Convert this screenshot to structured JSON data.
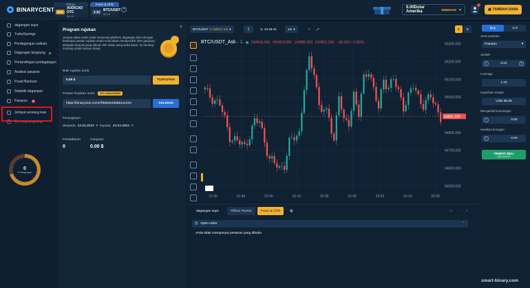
{
  "brand": {
    "name": "BINARYCENT"
  },
  "asset_tabs": [
    {
      "header": "Pilihan",
      "pct": "93%",
      "name": "AUD/CAD OTC",
      "price": "$1.00",
      "active": false
    },
    {
      "header": "Forex & CFD",
      "pct": "1:10",
      "name": "BTC/USDT",
      "price": "$3.00",
      "active": true
    }
  ],
  "topbar": {
    "add_asset": "+",
    "balance_value": "0.00Dolar Amerika",
    "balance_tag": "SEBENAR",
    "deposit_label": "TAMBAH DANA"
  },
  "sidebar": {
    "items": [
      {
        "label": "dagangan saya"
      },
      {
        "label": "TurboSavings"
      },
      {
        "label": "Perdagangan salinan"
      },
      {
        "label": "Dagangan langsung"
      },
      {
        "label": "Pertandingan perdagangan"
      },
      {
        "label": "Analisis pasaran"
      },
      {
        "label": "Pusat Bantuan"
      },
      {
        "label": "Statistik dagangan"
      },
      {
        "label": "Pasaran",
        "badge": "9"
      },
      {
        "label": "Jemput seorang kaw"
      },
      {
        "label": "Semuag langsung"
      }
    ],
    "donut": {
      "value": "0",
      "label": "Perdagangan"
    }
  },
  "referral": {
    "close": "×",
    "title": "Program rujukan",
    "description": "Jemput rakan anda untuk menyertai platform dagangan kami dengan beberapa pautan rujukan anda! Anda akan memperoleh 20% ganjaran daripada deposit yang dibuat oleh rakan yang anda bawa. Ia menang-menang untuk semua orang!",
    "bonus_label": "Baki rujukan anda",
    "bonus_value": "0.00 $",
    "withdraw_btn": "TUNTUTAN",
    "link_label": "Pautan Rujukan anda",
    "link_tag": "20% GANJARAN",
    "link_value": "https://binarycent.com/r/f868354d9661ec034",
    "copy_btn": "SALINAN",
    "stats_title": "Perangkaan",
    "date_from_label": "daripada",
    "date_from": "22.04.2023",
    "date_to_label": "kepada",
    "date_to": "22.04.2023",
    "signups_label": "Pendaftaran",
    "signups_value": "0",
    "earnings_label": "Ganjaran",
    "earnings_value": "0.00 $"
  },
  "chart_toolbar": {
    "asset": "BTC/USDT",
    "asset_mult": "1:10/$1(1:10)",
    "time": "23:25:43",
    "timeframe": "1m",
    "currency_a": "$",
    "currency_b": "€"
  },
  "chart_data": {
    "type": "candlestick",
    "title": "BTC/USDT_Ask · 1",
    "ohlc_text": {
      "o": "O64916.660",
      "h": "H64923.060",
      "l": "L64885.600",
      "c": "C64891.200",
      "chg": "−38.320 (−0.06%)"
    },
    "x_ticks": [
      "21:30",
      "21:45",
      "22:00",
      "22:15",
      "22:30",
      "22:45",
      "23:00",
      "23:15",
      "23:30"
    ],
    "y_ticks": [
      "65300.000",
      "65200.000",
      "65100.000",
      "65000.000",
      "64900.000",
      "64800.000",
      "64700.000",
      "64600.000",
      "64500.000"
    ],
    "ylim": [
      64470,
      65330
    ],
    "last_price": "64891.200",
    "last_price_value": 64891.2,
    "colors": {
      "up": "#26a69a",
      "down": "#ef5350"
    },
    "candle_count": 96,
    "anchors": [
      [
        0,
        65030
      ],
      [
        6,
        64960
      ],
      [
        10,
        64780
      ],
      [
        16,
        64720
      ],
      [
        20,
        64860
      ],
      [
        22,
        64860
      ],
      [
        26,
        64650
      ],
      [
        30,
        64600
      ],
      [
        32,
        64620
      ],
      [
        34,
        64740
      ],
      [
        38,
        64800
      ],
      [
        40,
        65060
      ],
      [
        42,
        65200
      ],
      [
        44,
        65140
      ],
      [
        46,
        64960
      ],
      [
        50,
        64880
      ],
      [
        52,
        64760
      ],
      [
        54,
        65020
      ],
      [
        56,
        64850
      ],
      [
        58,
        64860
      ],
      [
        60,
        65020
      ],
      [
        62,
        64900
      ],
      [
        64,
        65100
      ],
      [
        66,
        65160
      ],
      [
        70,
        64930
      ],
      [
        72,
        65100
      ],
      [
        74,
        65060
      ],
      [
        76,
        65100
      ],
      [
        80,
        64950
      ],
      [
        84,
        65060
      ],
      [
        86,
        65000
      ],
      [
        88,
        64960
      ],
      [
        91,
        65000
      ],
      [
        95,
        64891
      ]
    ]
  },
  "bottom": {
    "tab_trades": "dagangan saya",
    "tab_options": "Pilihan Pantas",
    "tab_forex": "Forex & CFD",
    "open_orders": "Open order",
    "empty": "Anda tidak mempunyai pesanan yang dibuka"
  },
  "trade": {
    "buy": "Buy",
    "sell": "Sell",
    "order_type_label": "Jenis pesanan",
    "order_type": "Pasaran",
    "amount_label": "Jumlah",
    "amount": "0.01",
    "leverage_label": "Leverage",
    "leverage": "1:10",
    "margin_label": "Keperluan margin",
    "margin": "USD 65.08",
    "tp_label": "Mengambil keuntungan",
    "tp": "0.00",
    "sl_label": "Hentikan kerugian",
    "sl": "0.00",
    "place_btn": "TEMPAT BELI",
    "place_sub": "USD 649.90"
  },
  "watermark": "smart-binary.com"
}
